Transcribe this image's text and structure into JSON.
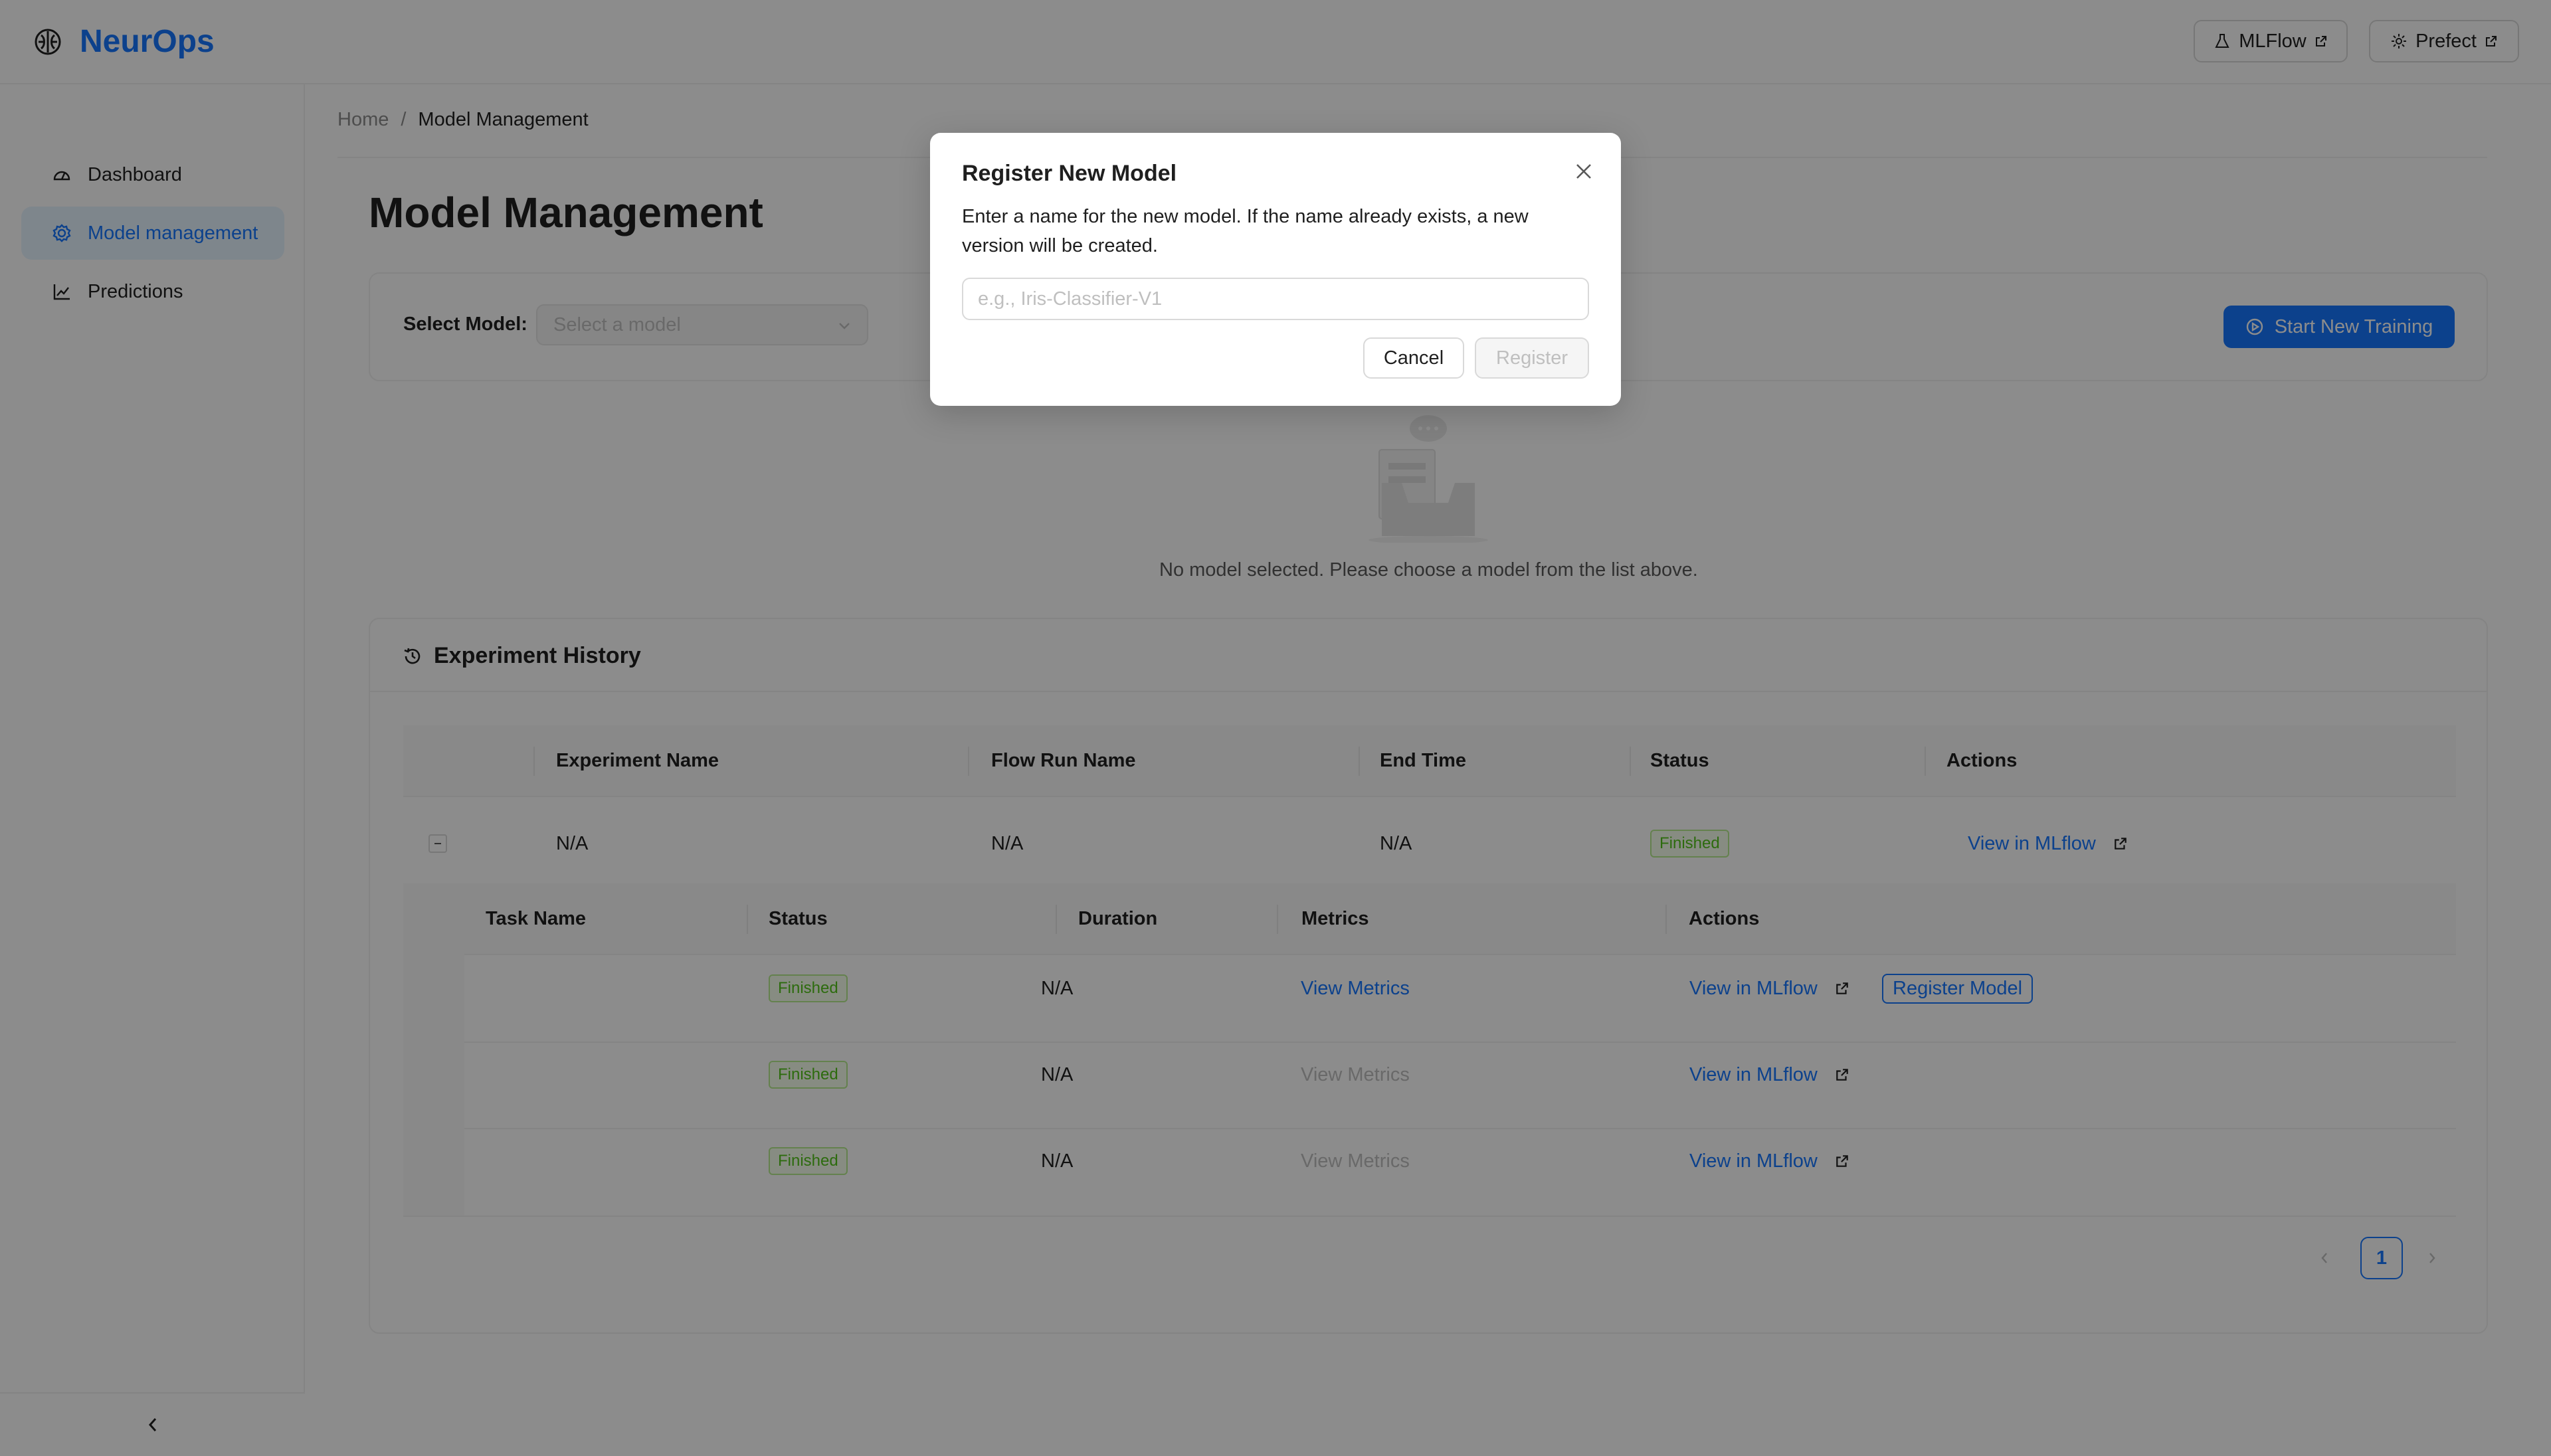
{
  "app": {
    "brand": "NeurOps",
    "accent_color": "#1677ff",
    "links": [
      {
        "label": "MLFlow",
        "icon": "flask-icon"
      },
      {
        "label": "Prefect",
        "icon": "gear-icon"
      }
    ]
  },
  "sidebar": {
    "items": [
      {
        "label": "Dashboard",
        "icon": "dashboard-icon",
        "active": false
      },
      {
        "label": "Model management",
        "icon": "settings-icon",
        "active": true
      },
      {
        "label": "Predictions",
        "icon": "line-chart-icon",
        "active": false
      }
    ],
    "collapse_icon": "chevron-left-icon"
  },
  "breadcrumb": {
    "home": "Home",
    "separator": "/",
    "current": "Model Management"
  },
  "page": {
    "title": "Model Management"
  },
  "model_select": {
    "label": "Select Model:",
    "placeholder": "Select a model",
    "start_training_label": "Start New Training"
  },
  "empty": {
    "message": "No model selected. Please choose a model from the list above."
  },
  "experiment_history": {
    "title": "Experiment History",
    "columns": [
      "Experiment Name",
      "Flow Run Name",
      "End Time",
      "Status",
      "Actions"
    ],
    "row": {
      "experiment_name": "N/A",
      "flow_run_name": "N/A",
      "end_time": "N/A",
      "status": "Finished",
      "action": "View in MLflow"
    },
    "task_columns": [
      "Task Name",
      "Status",
      "Duration",
      "Metrics",
      "Actions"
    ],
    "tasks": [
      {
        "name": "",
        "status": "Finished",
        "duration": "N/A",
        "metrics": "View Metrics",
        "metrics_enabled": true,
        "action": "View in MLflow",
        "register": "Register Model"
      },
      {
        "name": "",
        "status": "Finished",
        "duration": "N/A",
        "metrics": "View Metrics",
        "metrics_enabled": false,
        "action": "View in MLflow",
        "register": ""
      },
      {
        "name": "",
        "status": "Finished",
        "duration": "N/A",
        "metrics": "View Metrics",
        "metrics_enabled": false,
        "action": "View in MLflow",
        "register": ""
      }
    ],
    "pagination": {
      "current": "1"
    }
  },
  "modal": {
    "title": "Register New Model",
    "description": "Enter a name for the new model. If the name already exists, a new version will be created.",
    "input_placeholder": "e.g., Iris-Classifier-V1",
    "cancel_label": "Cancel",
    "register_label": "Register"
  }
}
